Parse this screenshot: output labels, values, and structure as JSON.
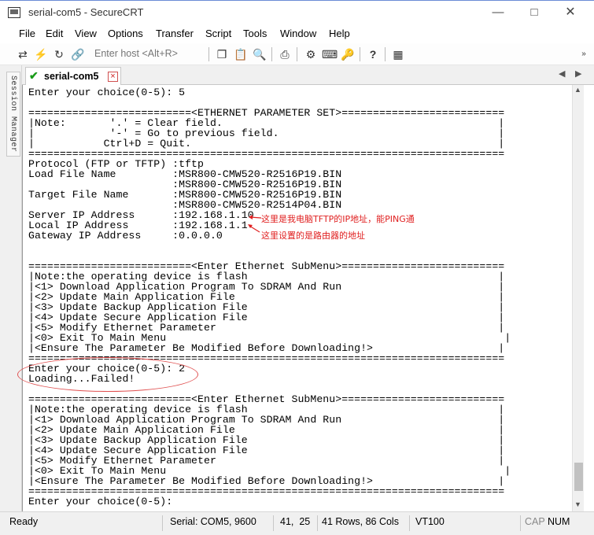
{
  "window": {
    "title": "serial-com5 - SecureCRT"
  },
  "menu": [
    "File",
    "Edit",
    "View",
    "Options",
    "Transfer",
    "Script",
    "Tools",
    "Window",
    "Help"
  ],
  "toolbar": {
    "host_placeholder": "Enter host <Alt+R>",
    "icons": [
      "connect-icon",
      "quick-connect-icon",
      "reconnect-icon",
      "disconnect-icon",
      "copy-icon",
      "paste-icon",
      "find-icon",
      "print-icon",
      "settings-icon",
      "keymap-icon",
      "sftp-icon",
      "help-icon",
      "script-icon"
    ]
  },
  "session_manager": {
    "label": "Session Manager"
  },
  "tab": {
    "label": "serial-com5",
    "close": "×"
  },
  "terminal": {
    "lines": [
      "Enter your choice(0-5): 5",
      "",
      "==========================<ETHERNET PARAMETER SET>==========================",
      "|Note:       '.' = Clear field.                                            |",
      "|            '-' = Go to previous field.                                   |",
      "|           Ctrl+D = Quit.                                                 |",
      "============================================================================",
      "Protocol (FTP or TFTP) :tftp",
      "Load File Name         :MSR800-CMW520-R2516P19.BIN",
      "                       :MSR800-CMW520-R2516P19.BIN",
      "Target File Name       :MSR800-CMW520-R2516P19.BIN",
      "                       :MSR800-CMW520-R2514P04.BIN",
      "Server IP Address      :192.168.1.10",
      "Local IP Address       :192.168.1.1",
      "Gateway IP Address     :0.0.0.0",
      "",
      "",
      "==========================<Enter Ethernet SubMenu>==========================",
      "|Note:the operating device is flash                                        |",
      "|<1> Download Application Program To SDRAM And Run                         |",
      "|<2> Update Main Application File                                          |",
      "|<3> Update Backup Application File                                        |",
      "|<4> Update Secure Application File                                        |",
      "|<5> Modify Ethernet Parameter                                             |",
      "|<0> Exit To Main Menu                                                      |",
      "|<Ensure The Parameter Be Modified Before Downloading!>                    |",
      "============================================================================",
      "Enter your choice(0-5): 2",
      "Loading...Failed!",
      "",
      "==========================<Enter Ethernet SubMenu>==========================",
      "|Note:the operating device is flash                                        |",
      "|<1> Download Application Program To SDRAM And Run                         |",
      "|<2> Update Main Application File                                          |",
      "|<3> Update Backup Application File                                        |",
      "|<4> Update Secure Application File                                        |",
      "|<5> Modify Ethernet Parameter                                             |",
      "|<0> Exit To Main Menu                                                      |",
      "|<Ensure The Parameter Be Modified Before Downloading!>                    |",
      "============================================================================",
      "Enter your choice(0-5):"
    ]
  },
  "annotations": {
    "server_ip_note": "这里是我电脑TFTP的IP地址，能PING通",
    "local_ip_note": "这里设置的是路由器的地址",
    "color": "#e02020"
  },
  "status": {
    "ready": "Ready",
    "connection": "Serial: COM5, 9600",
    "cursor": "41,  25",
    "size": "41 Rows, 86 Cols",
    "emulation": "VT100",
    "cap": "CAP",
    "num": "NUM"
  }
}
